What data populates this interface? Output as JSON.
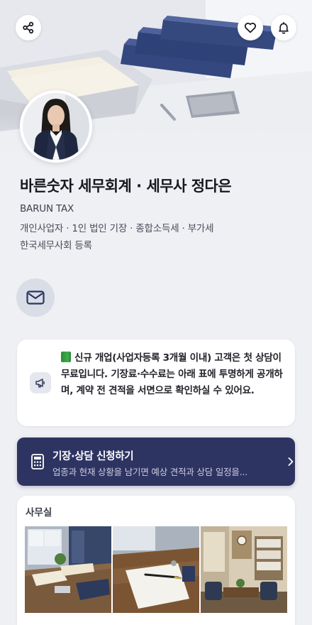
{
  "header": {
    "share_icon": "share-icon",
    "like_icon": "heart-icon",
    "notify_icon": "bell-icon"
  },
  "profile": {
    "name": "바른숫자 세무회계 · 세무사 정다은",
    "brand": "BARUN TAX",
    "services": "개인사업자 · 1인 법인 기장 · 종합소득세 · 부가세",
    "registration": "한국세무사회 등록",
    "contact_icon": "mail-icon"
  },
  "notice": {
    "icon": "megaphone-icon",
    "emoji_icon": "green-book-icon",
    "text": "신규 개업(사업자등록 3개월 이내) 고객은 첫 상담이 무료입니다. 기장료·수수료는 아래 표에 투명하게 공개하며, 계약 전 견적을 서면으로 확인하실 수 있어요."
  },
  "cta": {
    "icon": "calculator-icon",
    "title": "기장·상담 신청하기",
    "description": "업종과 현재 상황을 남기면 예상 견적과 상담 일정을...",
    "chevron": "chevron-right-icon"
  },
  "office": {
    "title": "사무실",
    "photos": [
      "office-desk-photo",
      "desk-paper-pen-photo",
      "meeting-room-photo"
    ]
  },
  "colors": {
    "background": "#eef0f4",
    "cta_background": "#2e3461",
    "card": "#ffffff"
  }
}
